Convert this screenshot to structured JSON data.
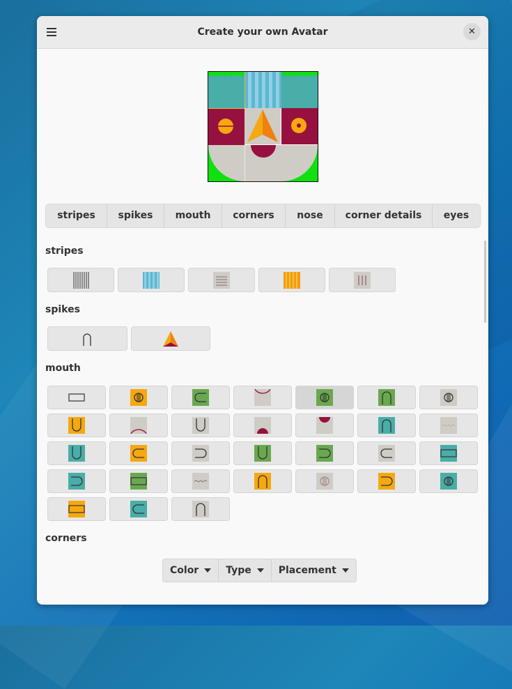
{
  "window": {
    "title": "Create your own Avatar"
  },
  "tabs": [
    "stripes",
    "spikes",
    "mouth",
    "corners",
    "nose",
    "corner details",
    "eyes"
  ],
  "sections": {
    "stripes": "stripes",
    "spikes": "spikes",
    "mouth": "mouth",
    "corners": "corners"
  },
  "bottom_bar": {
    "color_label": "Color",
    "type_label": "Type",
    "placement_label": "Placement"
  },
  "colors": {
    "teal": "#49ada8",
    "crimson": "#971140",
    "orange": "#f39c12",
    "yellow": "#f5a80f",
    "green": "#6aa84f",
    "bright_green": "#10e010",
    "light_blue": "#7ac6dd",
    "grey": "#cfccc6"
  },
  "icons": [
    "hamburger-menu-icon",
    "close-icon",
    "caret-down-icon"
  ]
}
